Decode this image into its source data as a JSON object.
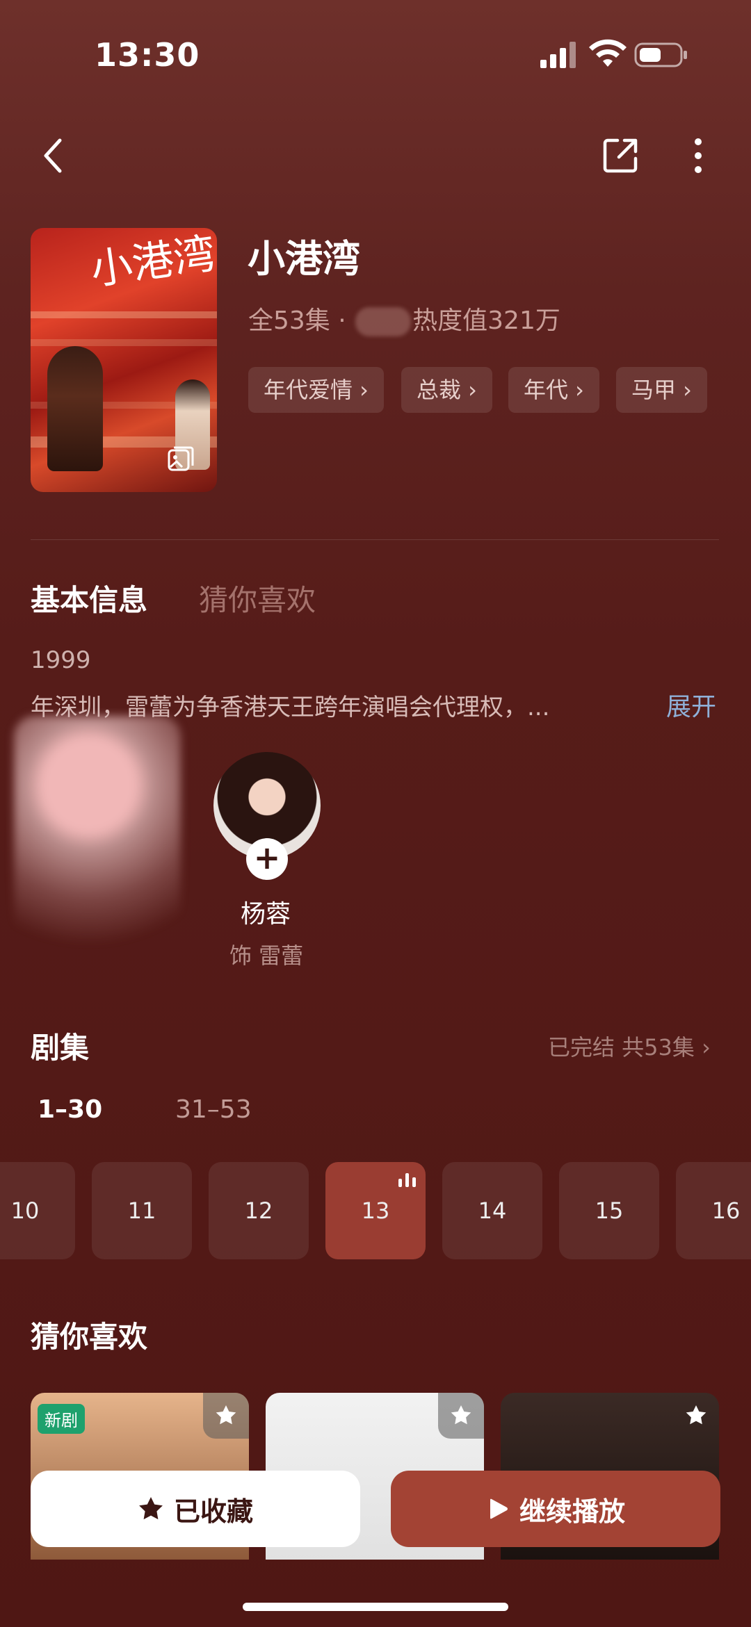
{
  "status": {
    "time": "13:30"
  },
  "nav": {
    "back_icon": "chevron-left-icon",
    "share_icon": "share-icon",
    "more_icon": "more-vertical-icon"
  },
  "show": {
    "poster_title": "小港湾",
    "title": "小港湾",
    "meta_left": "全53集 · ",
    "meta_right": "热度值321万",
    "tags": [
      "年代爱情 ›",
      "总裁 ›",
      "年代 ›",
      "马甲 ›"
    ]
  },
  "tabs": {
    "active": "基本信息",
    "other": "猜你喜欢"
  },
  "description": {
    "line1": "1999",
    "line2": "年深圳，雷蕾为争香港天王跨年演唱会代理权，...",
    "expand": "展开"
  },
  "cast": [
    {
      "name": "杨蓉",
      "role": "饰 雷蕾"
    }
  ],
  "episodes": {
    "title": "剧集",
    "status": "已完结 共53集 ›",
    "ranges": [
      "1–30",
      "31–53"
    ],
    "items": [
      "10",
      "11",
      "12",
      "13",
      "14",
      "15",
      "16"
    ],
    "current": "13"
  },
  "recommend": {
    "title": "猜你喜欢",
    "new_tag": "新剧"
  },
  "actions": {
    "favorite": "已收藏",
    "play": "继续播放"
  },
  "colors": {
    "accent": "#a34334",
    "link": "#8fb0d8",
    "new_tag": "#1ea16d"
  }
}
